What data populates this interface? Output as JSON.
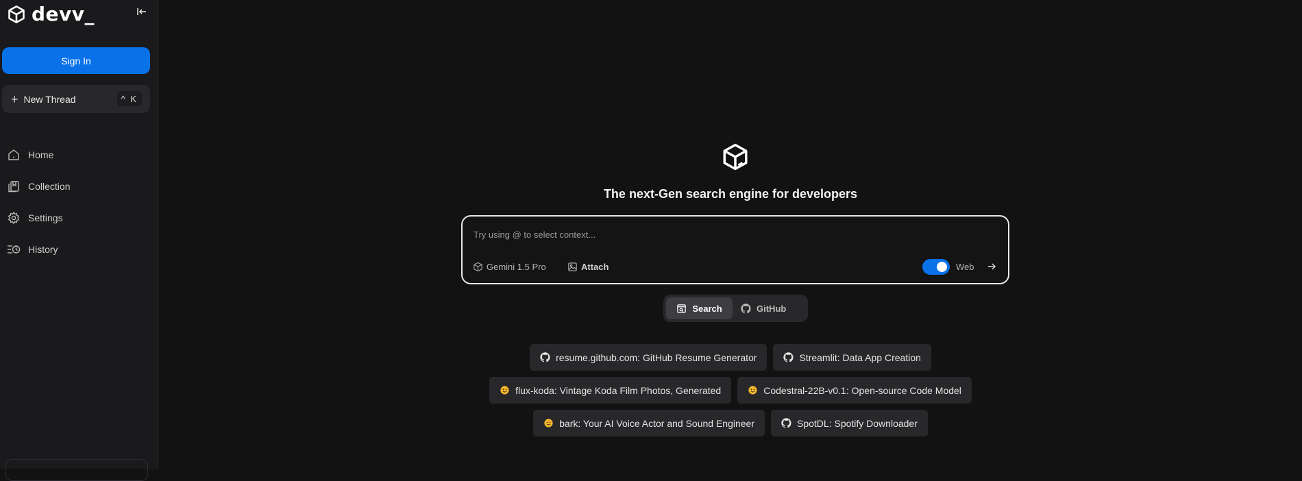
{
  "sidebar": {
    "brand": "devv_",
    "sign_in": "Sign In",
    "new_thread": {
      "label": "New Thread",
      "shortcut": "^ K"
    },
    "nav": [
      {
        "label": "Home",
        "icon": "home-icon"
      },
      {
        "label": "Collection",
        "icon": "collection-icon"
      },
      {
        "label": "Settings",
        "icon": "gear-icon"
      },
      {
        "label": "History",
        "icon": "history-icon"
      }
    ]
  },
  "main": {
    "tagline": "The next-Gen search engine for developers",
    "search": {
      "placeholder": "Try using @ to select context...",
      "model": "Gemini 1.5 Pro",
      "attach": "Attach",
      "web_label": "Web",
      "web_enabled": true
    },
    "modes": [
      {
        "label": "Search",
        "icon": "search-icon",
        "active": true
      },
      {
        "label": "GitHub",
        "icon": "github-icon",
        "active": false
      }
    ],
    "suggestions": [
      [
        {
          "label": "resume.github.com: GitHub Resume Generator",
          "icon": "github-icon"
        },
        {
          "label": "Streamlit: Data App Creation",
          "icon": "github-icon"
        }
      ],
      [
        {
          "label": "flux-koda: Vintage Koda Film Photos, Generated",
          "icon": "huggingface-icon"
        },
        {
          "label": "Codestral-22B-v0.1: Open-source Code Model",
          "icon": "huggingface-icon"
        }
      ],
      [
        {
          "label": "bark: Your AI Voice Actor and Sound Engineer",
          "icon": "huggingface-icon"
        },
        {
          "label": "SpotDL: Spotify Downloader",
          "icon": "github-icon"
        }
      ]
    ]
  },
  "colors": {
    "background": "#121213",
    "sidebar": "#1a1a1c",
    "accent": "#0a72e8",
    "chip": "#28282b"
  }
}
